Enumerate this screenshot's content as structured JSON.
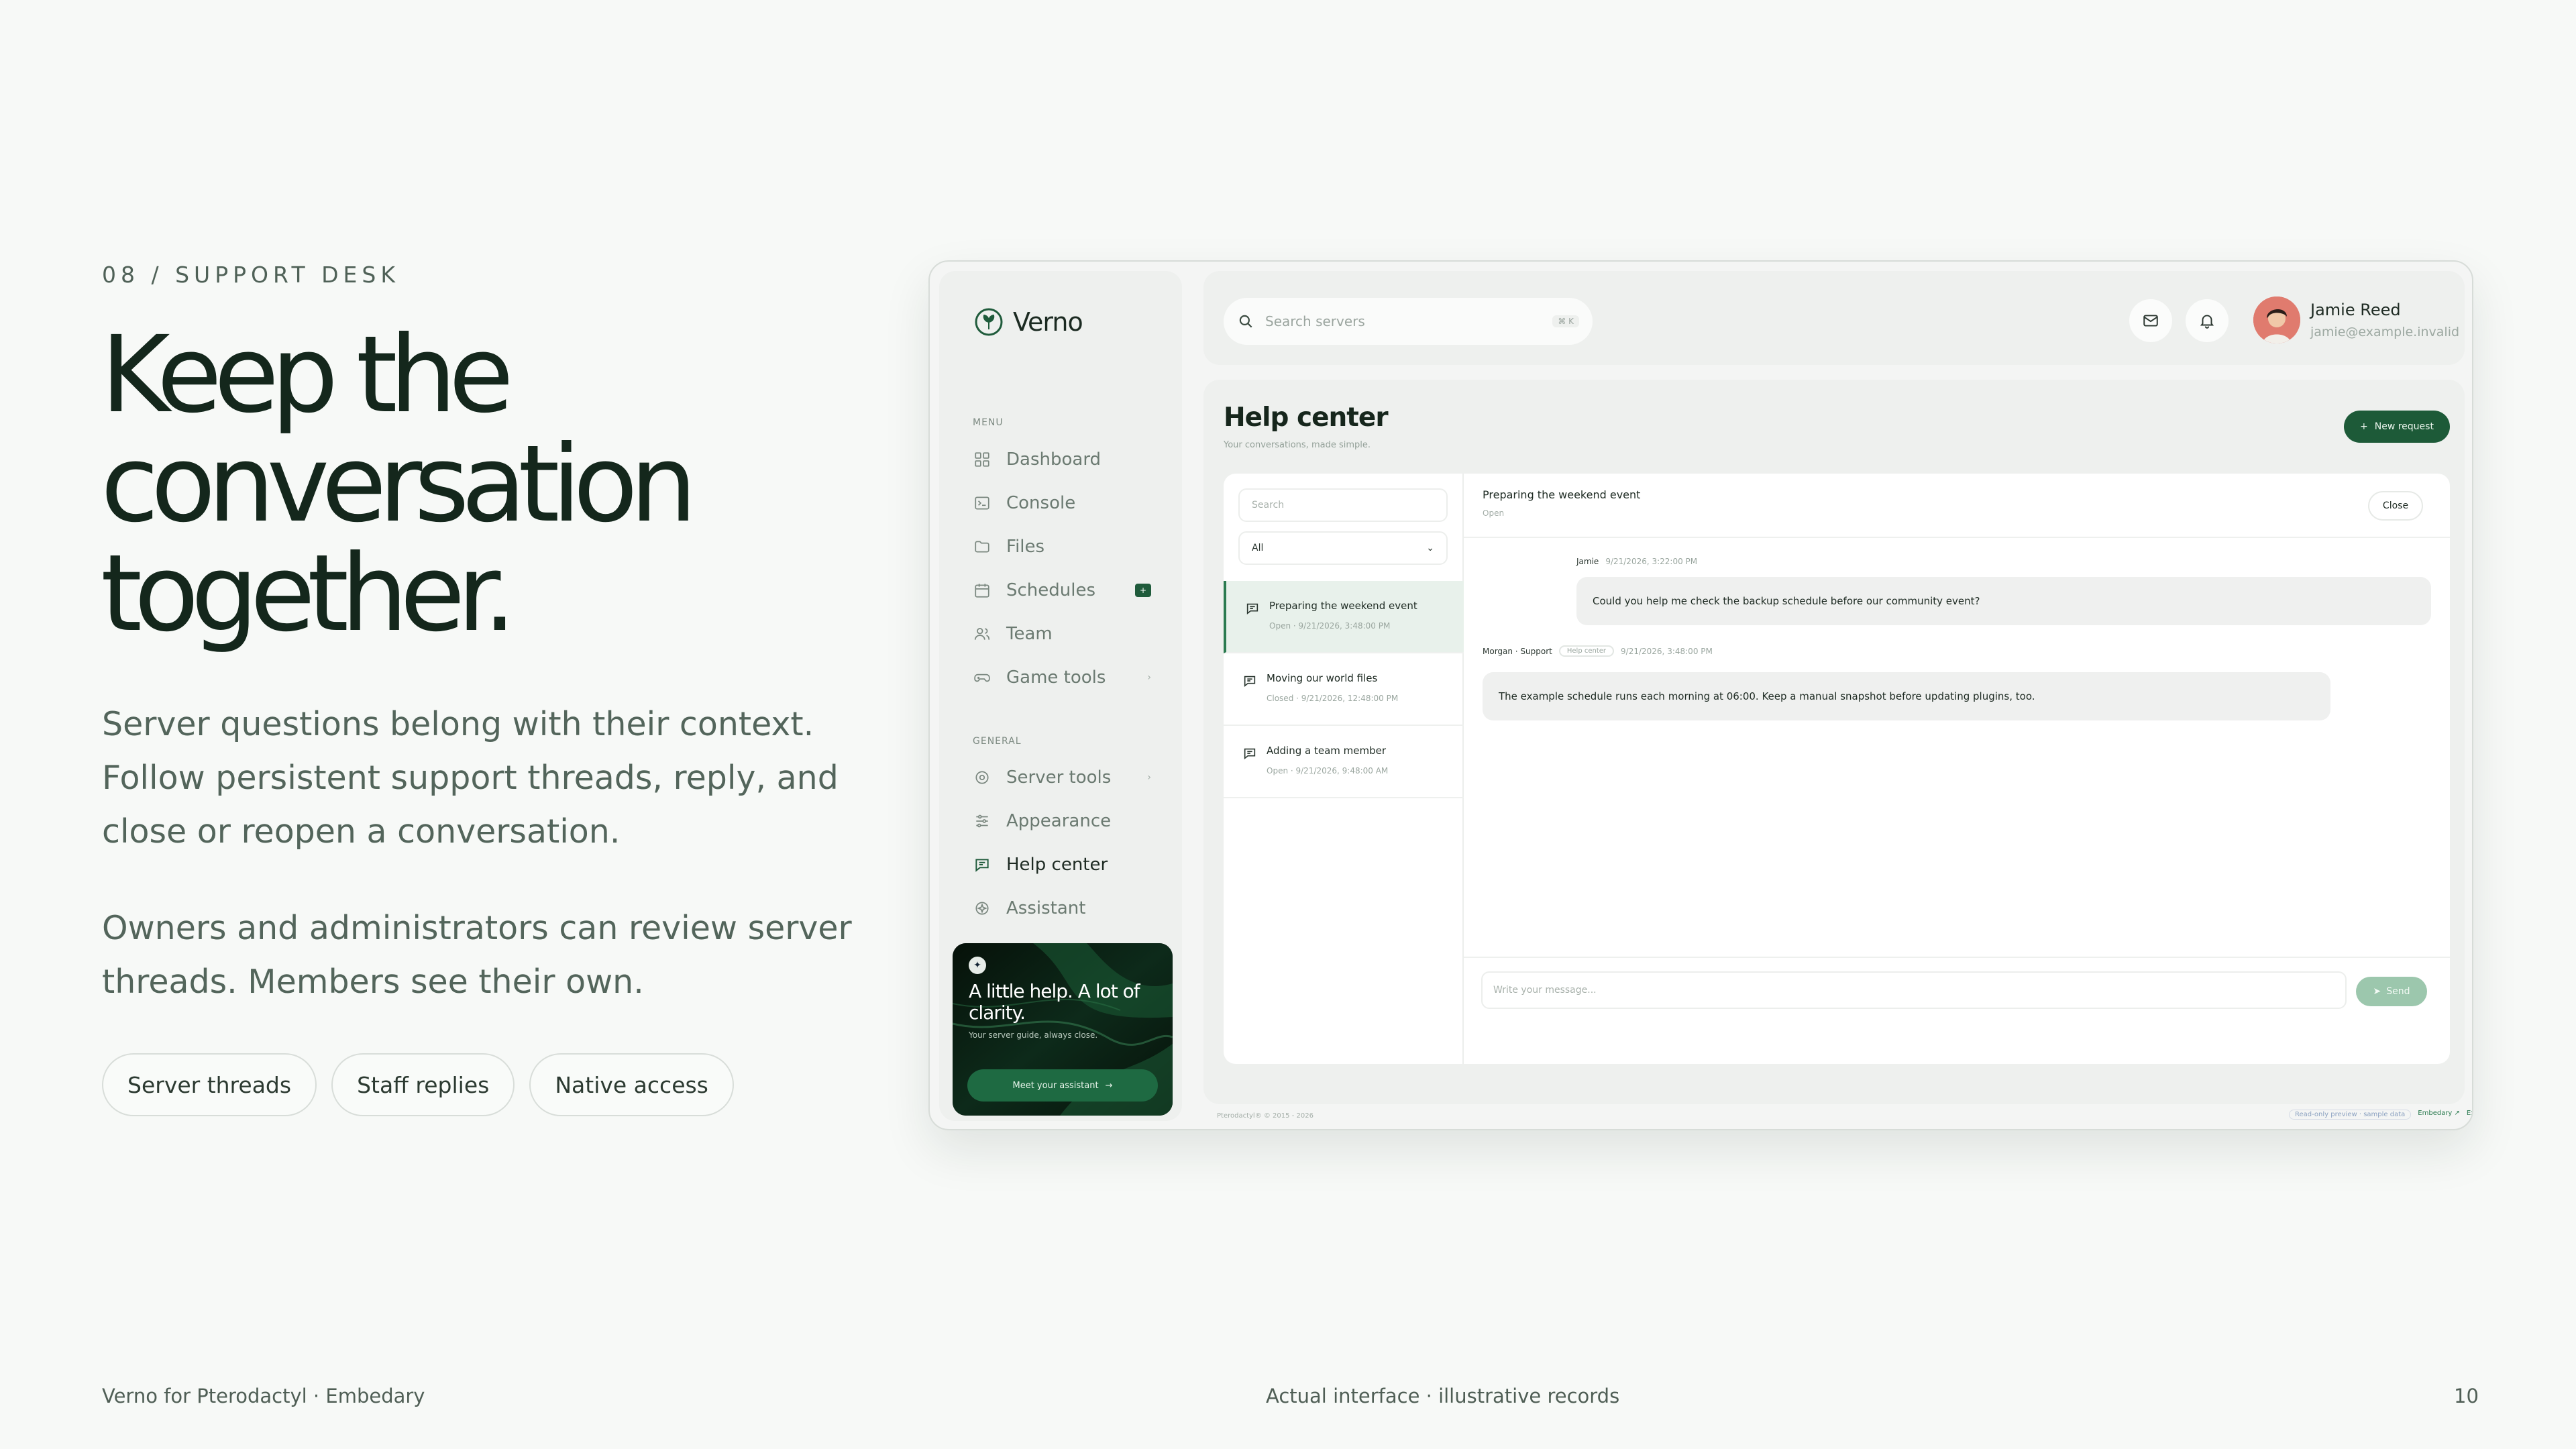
{
  "slide": {
    "eyebrow": "08 / SUPPORT DESK",
    "headline": "Keep the conversation together.",
    "paragraph_1": "Server questions belong with their context. Follow persistent support threads, reply, and close or reopen a conversation.",
    "paragraph_2": "Owners and administrators can review server threads. Members see their own.",
    "chips": [
      "Server threads",
      "Staff replies",
      "Native access"
    ],
    "footer_left": "Verno for Pterodactyl · Embedary",
    "footer_center": "Actual interface · illustrative records",
    "page_number": "10"
  },
  "app": {
    "brand": "Verno",
    "sidebar": {
      "menu_label": "MENU",
      "menu_items": [
        {
          "label": "Dashboard",
          "icon": "grid-icon"
        },
        {
          "label": "Console",
          "icon": "terminal-icon"
        },
        {
          "label": "Files",
          "icon": "folder-icon"
        },
        {
          "label": "Schedules",
          "icon": "calendar-icon",
          "badge": "+"
        },
        {
          "label": "Team",
          "icon": "users-icon"
        },
        {
          "label": "Game tools",
          "icon": "gamepad-icon",
          "trail": "›"
        }
      ],
      "general_label": "GENERAL",
      "general_items": [
        {
          "label": "Server tools",
          "icon": "target-icon",
          "trail": "›"
        },
        {
          "label": "Appearance",
          "icon": "sliders-icon"
        },
        {
          "label": "Help center",
          "icon": "message-icon",
          "active": true
        },
        {
          "label": "Assistant",
          "icon": "sparkle-icon"
        }
      ],
      "promo": {
        "title": "A little help. A lot of clarity.",
        "subtitle": "Your server guide, always close.",
        "button": "Meet your assistant"
      }
    },
    "topbar": {
      "search_placeholder": "Search servers",
      "search_shortcut": "⌘ K",
      "user_name": "Jamie Reed",
      "user_email": "jamie@example.invalid"
    },
    "help": {
      "title": "Help center",
      "subtitle": "Your conversations, made simple.",
      "new_button": "New request",
      "list_search_placeholder": "Search",
      "filter_value": "All",
      "threads": [
        {
          "title": "Preparing the weekend event",
          "meta": "Open · 9/21/2026, 3:48:00 PM",
          "active": true
        },
        {
          "title": "Moving our world files",
          "meta": "Closed · 9/21/2026, 12:48:00 PM"
        },
        {
          "title": "Adding a team member",
          "meta": "Open · 9/21/2026, 9:48:00 AM"
        }
      ],
      "conversation": {
        "title": "Preparing the weekend event",
        "status": "Open",
        "close_button": "Close",
        "messages": [
          {
            "author": "Jamie",
            "time": "9/21/2026, 3:22:00 PM",
            "text": "Could you help me check the backup schedule before our community event?"
          },
          {
            "author": "Morgan · Support",
            "tag": "Help center",
            "time": "9/21/2026, 3:48:00 PM",
            "text": "The example schedule runs each morning at 06:00. Keep a manual snapshot before updating plugins, too."
          }
        ],
        "composer_placeholder": "Write your message...",
        "send_button": "Send"
      }
    },
    "window_footer": {
      "left": "Pterodactyl® © 2015 - 2026",
      "preview": "Read-only preview · sample data",
      "link_1": "Embedary ↗",
      "link_2": "Exit"
    }
  }
}
